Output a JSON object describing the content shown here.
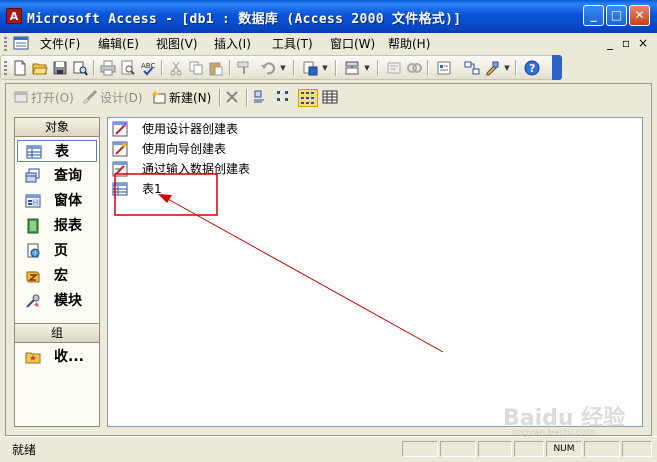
{
  "window": {
    "title": "Microsoft Access - [db1 : 数据库 (Access 2000 文件格式)]",
    "app_icon_letter": "A"
  },
  "menu": {
    "items": [
      {
        "label": "文件(F)"
      },
      {
        "label": "编辑(E)"
      },
      {
        "label": "视图(V)"
      },
      {
        "label": "插入(I)"
      },
      {
        "label": "工具(T)"
      },
      {
        "label": "窗口(W)"
      },
      {
        "label": "帮助(H)"
      }
    ]
  },
  "db_toolbar": {
    "open": "打开(O)",
    "design": "设计(D)",
    "new": "新建(N)"
  },
  "objects": {
    "header": "对象",
    "items": [
      {
        "label": "表",
        "icon": "table-icon"
      },
      {
        "label": "查询",
        "icon": "query-icon"
      },
      {
        "label": "窗体",
        "icon": "form-icon"
      },
      {
        "label": "报表",
        "icon": "report-icon"
      },
      {
        "label": "页",
        "icon": "page-icon"
      },
      {
        "label": "宏",
        "icon": "macro-icon"
      },
      {
        "label": "模块",
        "icon": "module-icon"
      }
    ],
    "groups_header": "组",
    "favorites": "收..."
  },
  "list": {
    "items": [
      {
        "label": "使用设计器创建表"
      },
      {
        "label": "使用向导创建表"
      },
      {
        "label": "通过输入数据创建表"
      },
      {
        "label": "表1"
      }
    ]
  },
  "status": {
    "text": "就绪",
    "num": "NUM"
  },
  "watermark": {
    "brand": "Baidu 经验",
    "url": "jingyan.baidu.com"
  },
  "colors": {
    "title_bar": "#0854d9",
    "annotation_red": "#d40000",
    "selection_border": "#5f7fc0"
  }
}
